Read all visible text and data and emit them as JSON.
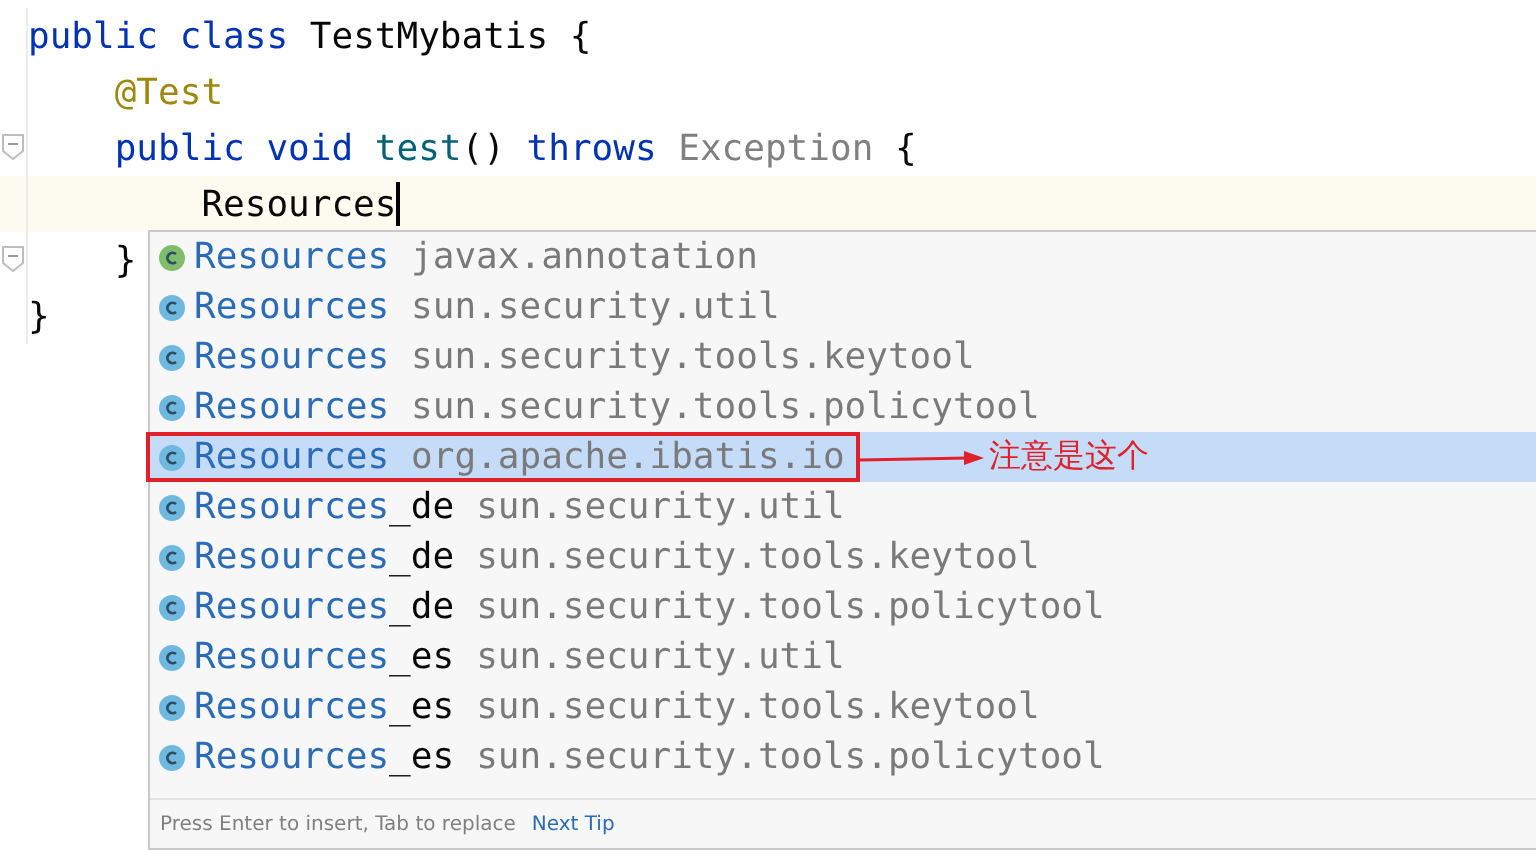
{
  "editor": {
    "lines": [
      {
        "fold": false,
        "current": false,
        "tokens": [
          {
            "kind": "keyword",
            "text": "public class "
          },
          {
            "kind": "plain",
            "text": "TestMybatis {"
          }
        ]
      },
      {
        "fold": false,
        "current": false,
        "tokens": [
          {
            "kind": "annotation",
            "text": "    @Test"
          }
        ]
      },
      {
        "fold": true,
        "current": false,
        "tokens": [
          {
            "kind": "keyword",
            "text": "    public void "
          },
          {
            "kind": "method",
            "text": "test"
          },
          {
            "kind": "plain",
            "text": "() "
          },
          {
            "kind": "keyword",
            "text": "throws "
          },
          {
            "kind": "type",
            "text": "Exception "
          },
          {
            "kind": "plain",
            "text": "{"
          }
        ]
      },
      {
        "fold": false,
        "current": true,
        "tokens": [
          {
            "kind": "plain",
            "text": "        Resources"
          }
        ]
      },
      {
        "fold": true,
        "current": false,
        "tokens": [
          {
            "kind": "plain",
            "text": "    }"
          }
        ]
      },
      {
        "fold": false,
        "current": false,
        "tokens": [
          {
            "kind": "plain",
            "text": "}"
          }
        ]
      }
    ]
  },
  "completion": {
    "items": [
      {
        "kind": "annotation",
        "name_match": "Resources",
        "package": "javax.annotation",
        "selected": false
      },
      {
        "kind": "class",
        "name_match": "Resources",
        "package": "sun.security.util",
        "selected": false
      },
      {
        "kind": "class",
        "name_match": "Resources",
        "package": "sun.security.tools.keytool",
        "selected": false
      },
      {
        "kind": "class",
        "name_match": "Resources",
        "package": "sun.security.tools.policytool",
        "selected": false
      },
      {
        "kind": "class",
        "name_match": "Resources",
        "package": "org.apache.ibatis.io",
        "selected": true,
        "note": "注意是这个"
      },
      {
        "kind": "class",
        "name_match": "Resources",
        "name_rest": "_de",
        "package": "sun.security.util",
        "selected": false
      },
      {
        "kind": "class",
        "name_match": "Resources",
        "name_rest": "_de",
        "package": "sun.security.tools.keytool",
        "selected": false
      },
      {
        "kind": "class",
        "name_match": "Resources",
        "name_rest": "_de",
        "package": "sun.security.tools.policytool",
        "selected": false
      },
      {
        "kind": "class",
        "name_match": "Resources",
        "name_rest": "_es",
        "package": "sun.security.util",
        "selected": false
      },
      {
        "kind": "class",
        "name_match": "Resources",
        "name_rest": "_es",
        "package": "sun.security.tools.keytool",
        "selected": false
      },
      {
        "kind": "class",
        "name_match": "Resources",
        "name_rest": "_es",
        "package": "sun.security.tools.policytool",
        "selected": false
      }
    ],
    "footer": {
      "hint": "Press Enter to insert, Tab to replace",
      "link": "Next Tip"
    }
  }
}
